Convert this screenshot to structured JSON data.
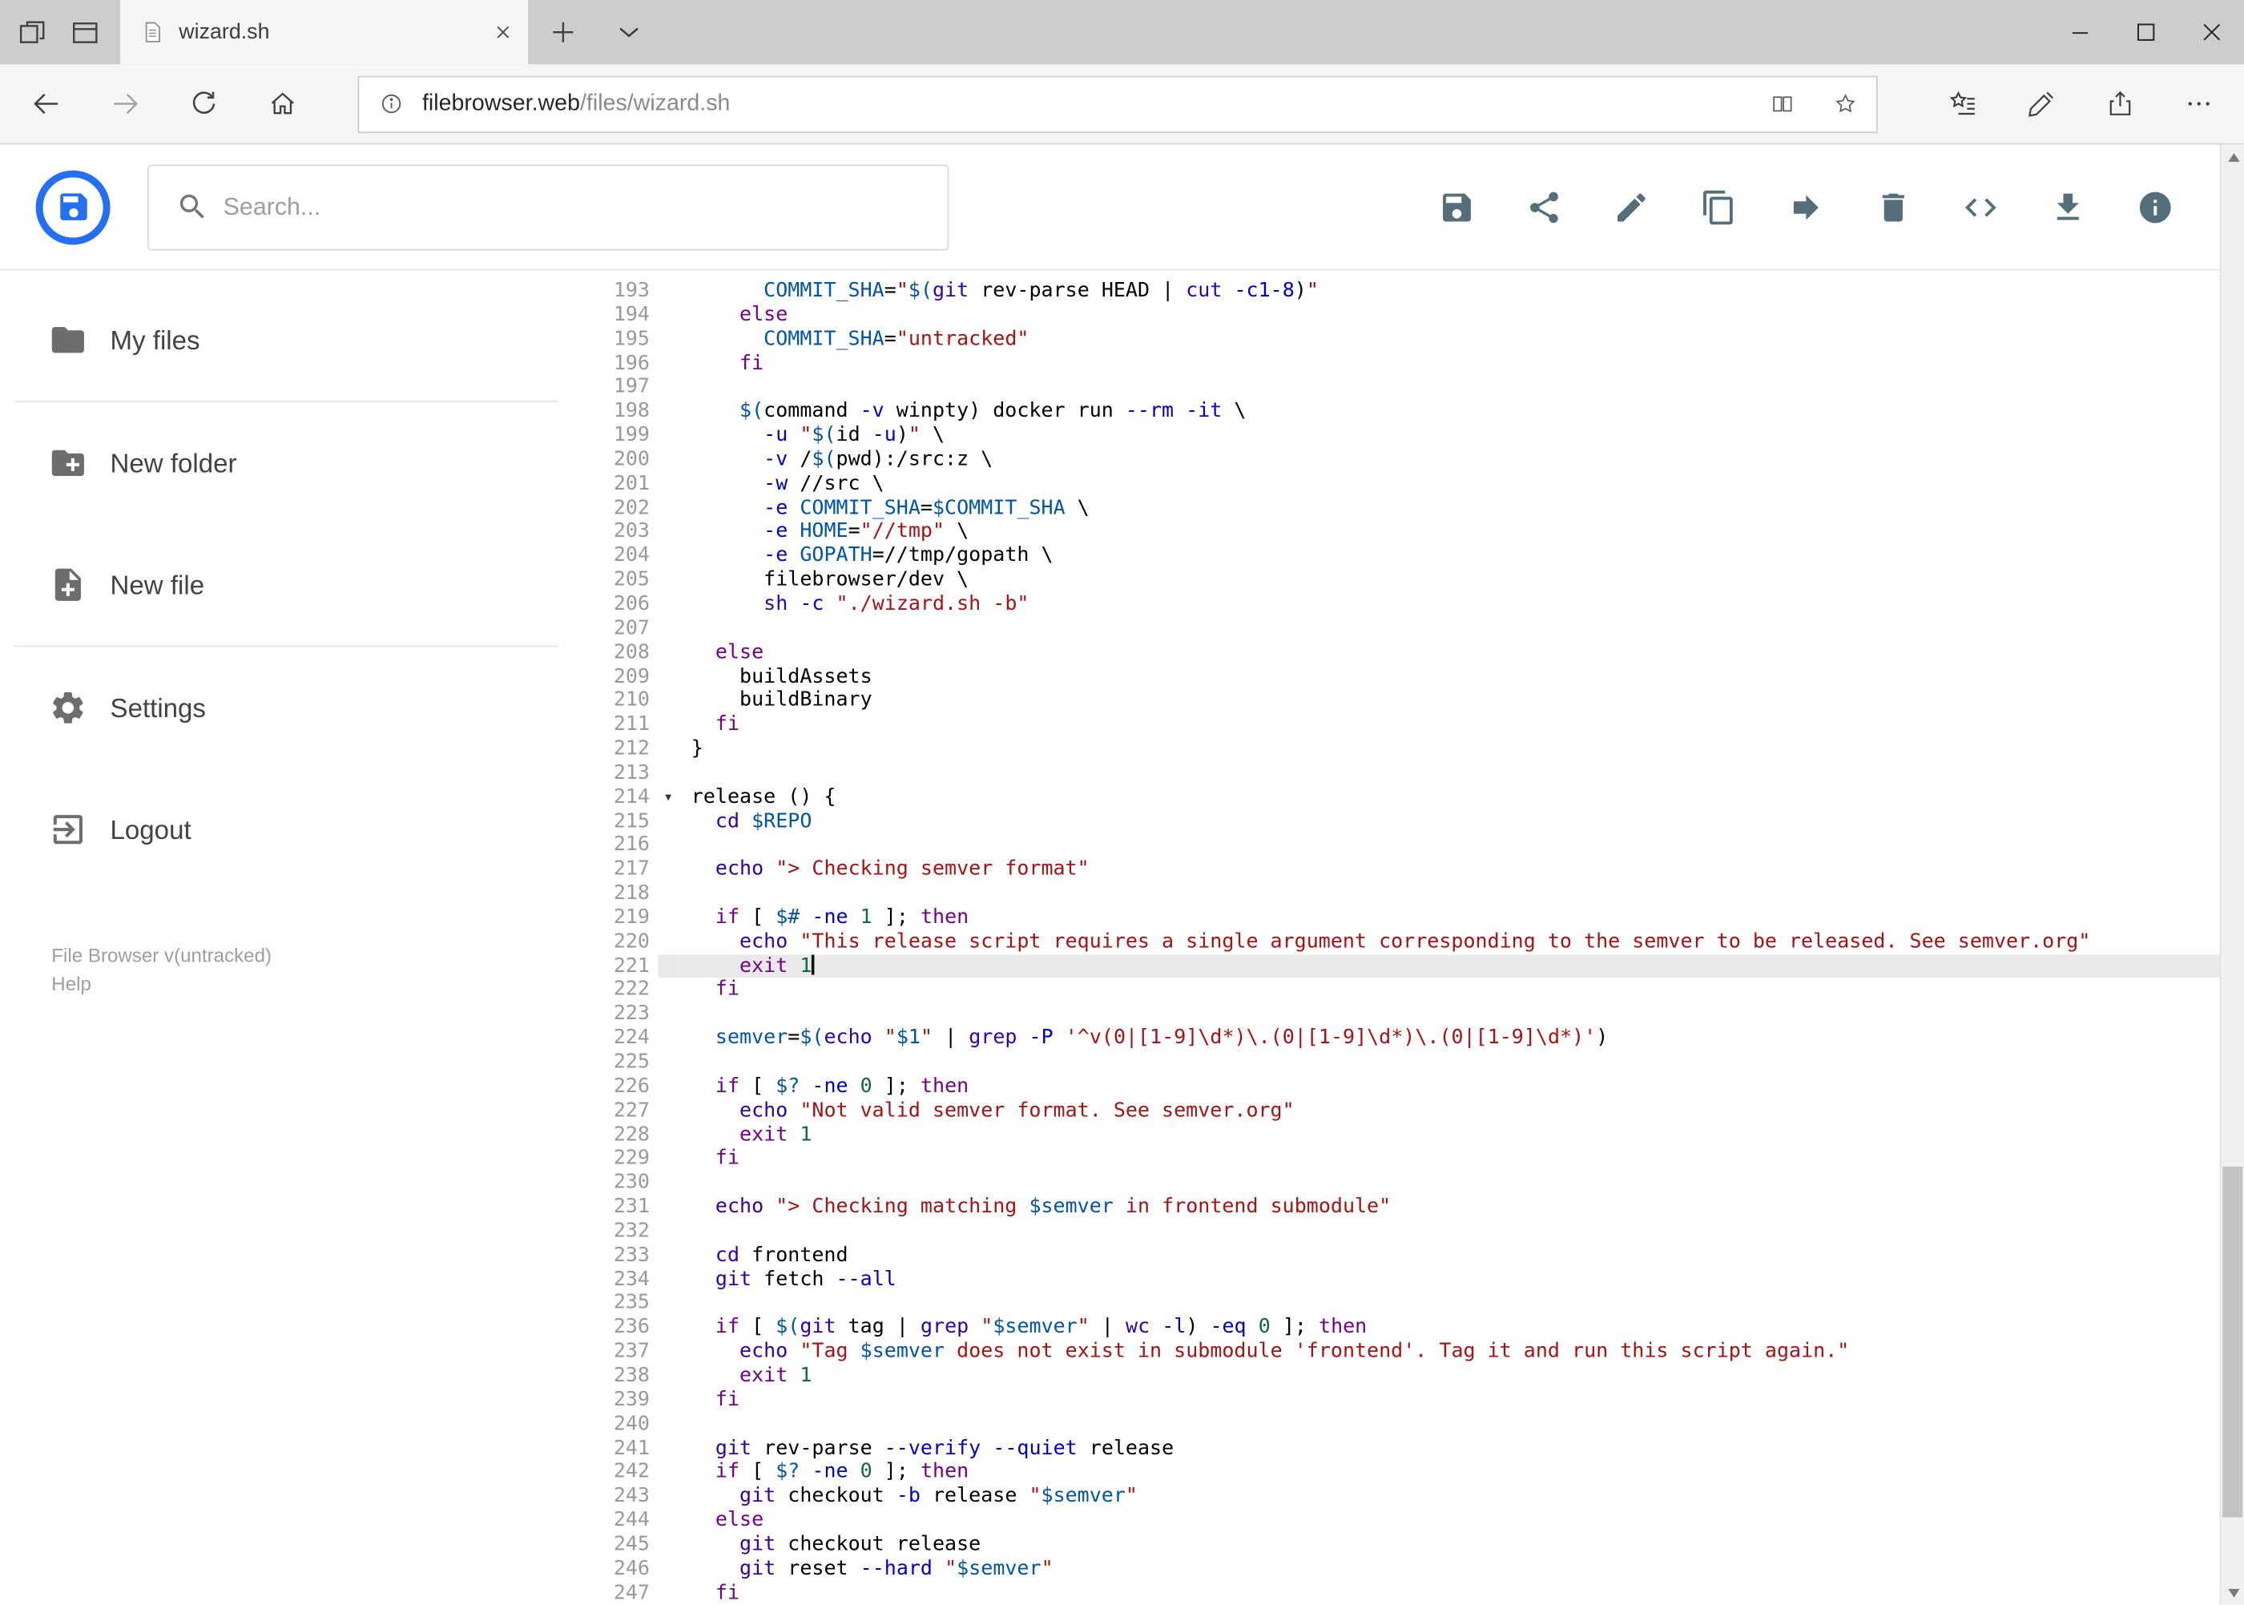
{
  "browser": {
    "tab_title": "wizard.sh",
    "url_domain": "filebrowser.web",
    "url_path": "/files/wizard.sh",
    "toolbar_icons": [
      "back-arrow",
      "forward-arrow",
      "refresh",
      "home",
      "site-info",
      "reading-view",
      "favorite-star",
      "hub",
      "web-note",
      "share",
      "more-options"
    ],
    "window_control_icons": [
      "minimize",
      "maximize",
      "close"
    ]
  },
  "header": {
    "search_placeholder": "Search...",
    "action_icons": [
      "save",
      "share",
      "edit",
      "copy",
      "move",
      "delete",
      "code",
      "download",
      "info"
    ]
  },
  "sidebar": {
    "items": [
      {
        "label": "My files",
        "icon": "folder"
      },
      {
        "label": "New folder",
        "icon": "create-new-folder"
      },
      {
        "label": "New file",
        "icon": "new-file"
      },
      {
        "label": "Settings",
        "icon": "settings-gear"
      },
      {
        "label": "Logout",
        "icon": "logout"
      }
    ],
    "footer": {
      "version": "File Browser v(untracked)",
      "help": "Help"
    }
  },
  "colors": {
    "brand_blue": "#2470f4",
    "action_icon": "#546e7a",
    "active_line_bg": "#e9e9e9",
    "syntax": {
      "keyword": "#770088",
      "builtin": "#3300aa",
      "string": "#aa1111",
      "variable": "#0055aa",
      "attribute": "#0000cc",
      "number": "#116644",
      "plain": "#000000"
    }
  },
  "editor": {
    "active_line": 221,
    "cursor_line": 221,
    "fold_marker_line": 214,
    "lines": [
      {
        "n": 193,
        "s": [
          [
            "p",
            "      "
          ],
          [
            "v",
            "COMMIT_SHA"
          ],
          [
            "p",
            "="
          ],
          [
            "s",
            "\""
          ],
          [
            "v",
            "$("
          ],
          [
            "b",
            "git"
          ],
          [
            "p",
            " rev-parse HEAD | "
          ],
          [
            "b",
            "cut"
          ],
          [
            "p",
            " "
          ],
          [
            "a",
            "-c1-8"
          ],
          [
            "p",
            ")"
          ],
          [
            "s",
            "\""
          ]
        ]
      },
      {
        "n": 194,
        "s": [
          [
            "p",
            "    "
          ],
          [
            "k",
            "else"
          ]
        ]
      },
      {
        "n": 195,
        "s": [
          [
            "p",
            "      "
          ],
          [
            "v",
            "COMMIT_SHA"
          ],
          [
            "p",
            "="
          ],
          [
            "s",
            "\"untracked\""
          ]
        ]
      },
      {
        "n": 196,
        "s": [
          [
            "p",
            "    "
          ],
          [
            "k",
            "fi"
          ]
        ]
      },
      {
        "n": 197,
        "s": []
      },
      {
        "n": 198,
        "s": [
          [
            "p",
            "    "
          ],
          [
            "v",
            "$("
          ],
          [
            "p",
            "command "
          ],
          [
            "a",
            "-v"
          ],
          [
            "p",
            " winpty) docker run "
          ],
          [
            "a",
            "--rm"
          ],
          [
            "p",
            " "
          ],
          [
            "a",
            "-it"
          ],
          [
            "p",
            " \\"
          ]
        ]
      },
      {
        "n": 199,
        "s": [
          [
            "p",
            "      "
          ],
          [
            "a",
            "-u"
          ],
          [
            "p",
            " "
          ],
          [
            "s",
            "\""
          ],
          [
            "v",
            "$("
          ],
          [
            "p",
            "id "
          ],
          [
            "a",
            "-u"
          ],
          [
            "p",
            ")"
          ],
          [
            "s",
            "\""
          ],
          [
            "p",
            " \\"
          ]
        ]
      },
      {
        "n": 200,
        "s": [
          [
            "p",
            "      "
          ],
          [
            "a",
            "-v"
          ],
          [
            "p",
            " /"
          ],
          [
            "v",
            "$("
          ],
          [
            "p",
            "pwd):/src:z \\"
          ]
        ]
      },
      {
        "n": 201,
        "s": [
          [
            "p",
            "      "
          ],
          [
            "a",
            "-w"
          ],
          [
            "p",
            " //src \\"
          ]
        ]
      },
      {
        "n": 202,
        "s": [
          [
            "p",
            "      "
          ],
          [
            "a",
            "-e"
          ],
          [
            "p",
            " "
          ],
          [
            "v",
            "COMMIT_SHA"
          ],
          [
            "p",
            "="
          ],
          [
            "v",
            "$COMMIT_SHA"
          ],
          [
            "p",
            " \\"
          ]
        ]
      },
      {
        "n": 203,
        "s": [
          [
            "p",
            "      "
          ],
          [
            "a",
            "-e"
          ],
          [
            "p",
            " "
          ],
          [
            "v",
            "HOME"
          ],
          [
            "p",
            "="
          ],
          [
            "s",
            "\"//tmp\""
          ],
          [
            "p",
            " \\"
          ]
        ]
      },
      {
        "n": 204,
        "s": [
          [
            "p",
            "      "
          ],
          [
            "a",
            "-e"
          ],
          [
            "p",
            " "
          ],
          [
            "v",
            "GOPATH"
          ],
          [
            "p",
            "=//tmp/gopath \\"
          ]
        ]
      },
      {
        "n": 205,
        "s": [
          [
            "p",
            "      filebrowser/dev \\"
          ]
        ]
      },
      {
        "n": 206,
        "s": [
          [
            "p",
            "      "
          ],
          [
            "b",
            "sh"
          ],
          [
            "p",
            " "
          ],
          [
            "a",
            "-c"
          ],
          [
            "p",
            " "
          ],
          [
            "s",
            "\"./wizard.sh -b\""
          ]
        ]
      },
      {
        "n": 207,
        "s": []
      },
      {
        "n": 208,
        "s": [
          [
            "p",
            "  "
          ],
          [
            "k",
            "else"
          ]
        ]
      },
      {
        "n": 209,
        "s": [
          [
            "p",
            "    buildAssets"
          ]
        ]
      },
      {
        "n": 210,
        "s": [
          [
            "p",
            "    buildBinary"
          ]
        ]
      },
      {
        "n": 211,
        "s": [
          [
            "p",
            "  "
          ],
          [
            "k",
            "fi"
          ]
        ]
      },
      {
        "n": 212,
        "s": [
          [
            "p",
            "}"
          ]
        ]
      },
      {
        "n": 213,
        "s": []
      },
      {
        "n": 214,
        "s": [
          [
            "p",
            "release () {"
          ]
        ]
      },
      {
        "n": 215,
        "s": [
          [
            "p",
            "  "
          ],
          [
            "b",
            "cd"
          ],
          [
            "p",
            " "
          ],
          [
            "v",
            "$REPO"
          ]
        ]
      },
      {
        "n": 216,
        "s": []
      },
      {
        "n": 217,
        "s": [
          [
            "p",
            "  "
          ],
          [
            "b",
            "echo"
          ],
          [
            "p",
            " "
          ],
          [
            "s",
            "\"> Checking semver format\""
          ]
        ]
      },
      {
        "n": 218,
        "s": []
      },
      {
        "n": 219,
        "s": [
          [
            "p",
            "  "
          ],
          [
            "k",
            "if"
          ],
          [
            "p",
            " [ "
          ],
          [
            "v",
            "$#"
          ],
          [
            "p",
            " "
          ],
          [
            "a",
            "-ne"
          ],
          [
            "p",
            " "
          ],
          [
            "n",
            "1"
          ],
          [
            "p",
            " ]; "
          ],
          [
            "k",
            "then"
          ]
        ]
      },
      {
        "n": 220,
        "s": [
          [
            "p",
            "    "
          ],
          [
            "b",
            "echo"
          ],
          [
            "p",
            " "
          ],
          [
            "s",
            "\"This release script requires a single argument corresponding to the semver to be released. See semver.org\""
          ]
        ]
      },
      {
        "n": 221,
        "s": [
          [
            "p",
            "    "
          ],
          [
            "k",
            "exit"
          ],
          [
            "p",
            " "
          ],
          [
            "n",
            "1"
          ]
        ]
      },
      {
        "n": 222,
        "s": [
          [
            "p",
            "  "
          ],
          [
            "k",
            "fi"
          ]
        ]
      },
      {
        "n": 223,
        "s": []
      },
      {
        "n": 224,
        "s": [
          [
            "p",
            "  "
          ],
          [
            "v",
            "semver"
          ],
          [
            "p",
            "="
          ],
          [
            "v",
            "$("
          ],
          [
            "b",
            "echo"
          ],
          [
            "p",
            " "
          ],
          [
            "s",
            "\""
          ],
          [
            "v",
            "$1"
          ],
          [
            "s",
            "\""
          ],
          [
            "p",
            " | "
          ],
          [
            "b",
            "grep"
          ],
          [
            "p",
            " "
          ],
          [
            "a",
            "-P"
          ],
          [
            "p",
            " "
          ],
          [
            "s",
            "'^v(0|[1-9]\\d*)\\.(0|[1-9]\\d*)\\.(0|[1-9]\\d*)'"
          ],
          [
            "p",
            ")"
          ]
        ]
      },
      {
        "n": 225,
        "s": []
      },
      {
        "n": 226,
        "s": [
          [
            "p",
            "  "
          ],
          [
            "k",
            "if"
          ],
          [
            "p",
            " [ "
          ],
          [
            "v",
            "$?"
          ],
          [
            "p",
            " "
          ],
          [
            "a",
            "-ne"
          ],
          [
            "p",
            " "
          ],
          [
            "n",
            "0"
          ],
          [
            "p",
            " ]; "
          ],
          [
            "k",
            "then"
          ]
        ]
      },
      {
        "n": 227,
        "s": [
          [
            "p",
            "    "
          ],
          [
            "b",
            "echo"
          ],
          [
            "p",
            " "
          ],
          [
            "s",
            "\"Not valid semver format. See semver.org\""
          ]
        ]
      },
      {
        "n": 228,
        "s": [
          [
            "p",
            "    "
          ],
          [
            "k",
            "exit"
          ],
          [
            "p",
            " "
          ],
          [
            "n",
            "1"
          ]
        ]
      },
      {
        "n": 229,
        "s": [
          [
            "p",
            "  "
          ],
          [
            "k",
            "fi"
          ]
        ]
      },
      {
        "n": 230,
        "s": []
      },
      {
        "n": 231,
        "s": [
          [
            "p",
            "  "
          ],
          [
            "b",
            "echo"
          ],
          [
            "p",
            " "
          ],
          [
            "s",
            "\"> Checking matching "
          ],
          [
            "v",
            "$semver"
          ],
          [
            "s",
            " in frontend submodule\""
          ]
        ]
      },
      {
        "n": 232,
        "s": []
      },
      {
        "n": 233,
        "s": [
          [
            "p",
            "  "
          ],
          [
            "b",
            "cd"
          ],
          [
            "p",
            " frontend"
          ]
        ]
      },
      {
        "n": 234,
        "s": [
          [
            "p",
            "  "
          ],
          [
            "b",
            "git"
          ],
          [
            "p",
            " fetch "
          ],
          [
            "a",
            "--all"
          ]
        ]
      },
      {
        "n": 235,
        "s": []
      },
      {
        "n": 236,
        "s": [
          [
            "p",
            "  "
          ],
          [
            "k",
            "if"
          ],
          [
            "p",
            " [ "
          ],
          [
            "v",
            "$("
          ],
          [
            "b",
            "git"
          ],
          [
            "p",
            " tag | "
          ],
          [
            "b",
            "grep"
          ],
          [
            "p",
            " "
          ],
          [
            "s",
            "\""
          ],
          [
            "v",
            "$semver"
          ],
          [
            "s",
            "\""
          ],
          [
            "p",
            " | "
          ],
          [
            "b",
            "wc"
          ],
          [
            "p",
            " "
          ],
          [
            "a",
            "-l"
          ],
          [
            "p",
            ") "
          ],
          [
            "a",
            "-eq"
          ],
          [
            "p",
            " "
          ],
          [
            "n",
            "0"
          ],
          [
            "p",
            " ]; "
          ],
          [
            "k",
            "then"
          ]
        ]
      },
      {
        "n": 237,
        "s": [
          [
            "p",
            "    "
          ],
          [
            "b",
            "echo"
          ],
          [
            "p",
            " "
          ],
          [
            "s",
            "\"Tag "
          ],
          [
            "v",
            "$semver"
          ],
          [
            "s",
            " does not exist in submodule 'frontend'. Tag it and run this script again.\""
          ]
        ]
      },
      {
        "n": 238,
        "s": [
          [
            "p",
            "    "
          ],
          [
            "k",
            "exit"
          ],
          [
            "p",
            " "
          ],
          [
            "n",
            "1"
          ]
        ]
      },
      {
        "n": 239,
        "s": [
          [
            "p",
            "  "
          ],
          [
            "k",
            "fi"
          ]
        ]
      },
      {
        "n": 240,
        "s": []
      },
      {
        "n": 241,
        "s": [
          [
            "p",
            "  "
          ],
          [
            "b",
            "git"
          ],
          [
            "p",
            " rev-parse "
          ],
          [
            "a",
            "--verify"
          ],
          [
            "p",
            " "
          ],
          [
            "a",
            "--quiet"
          ],
          [
            "p",
            " release"
          ]
        ]
      },
      {
        "n": 242,
        "s": [
          [
            "p",
            "  "
          ],
          [
            "k",
            "if"
          ],
          [
            "p",
            " [ "
          ],
          [
            "v",
            "$?"
          ],
          [
            "p",
            " "
          ],
          [
            "a",
            "-ne"
          ],
          [
            "p",
            " "
          ],
          [
            "n",
            "0"
          ],
          [
            "p",
            " ]; "
          ],
          [
            "k",
            "then"
          ]
        ]
      },
      {
        "n": 243,
        "s": [
          [
            "p",
            "    "
          ],
          [
            "b",
            "git"
          ],
          [
            "p",
            " checkout "
          ],
          [
            "a",
            "-b"
          ],
          [
            "p",
            " release "
          ],
          [
            "s",
            "\""
          ],
          [
            "v",
            "$semver"
          ],
          [
            "s",
            "\""
          ]
        ]
      },
      {
        "n": 244,
        "s": [
          [
            "p",
            "  "
          ],
          [
            "k",
            "else"
          ]
        ]
      },
      {
        "n": 245,
        "s": [
          [
            "p",
            "    "
          ],
          [
            "b",
            "git"
          ],
          [
            "p",
            " checkout release"
          ]
        ]
      },
      {
        "n": 246,
        "s": [
          [
            "p",
            "    "
          ],
          [
            "b",
            "git"
          ],
          [
            "p",
            " reset "
          ],
          [
            "a",
            "--hard"
          ],
          [
            "p",
            " "
          ],
          [
            "s",
            "\""
          ],
          [
            "v",
            "$semver"
          ],
          [
            "s",
            "\""
          ]
        ]
      },
      {
        "n": 247,
        "s": [
          [
            "p",
            "  "
          ],
          [
            "k",
            "fi"
          ]
        ]
      }
    ]
  }
}
